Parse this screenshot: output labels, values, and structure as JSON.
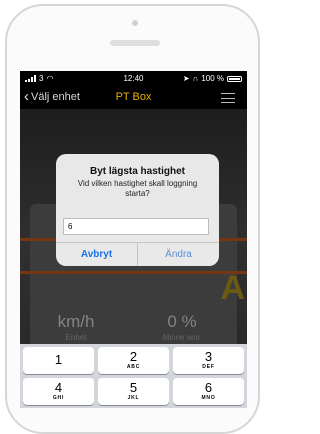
{
  "status_bar": {
    "carrier": "3",
    "time": "12:40",
    "battery": "100 %"
  },
  "nav": {
    "back_label": "Välj enhet",
    "title": "PT Box"
  },
  "background": {
    "unit_value": "km/h",
    "unit_label": "Enhet",
    "memory_value": "0 %",
    "memory_label": "Minne anv.",
    "partial_letter": "A"
  },
  "dialog": {
    "title": "Byt lägsta hastighet",
    "message": "Vid vilken hastighet skall loggning starta?",
    "input_value": "6",
    "cancel_label": "Avbryt",
    "confirm_label": "Ändra"
  },
  "keyboard": {
    "keys": [
      {
        "digit": "1",
        "letters": ""
      },
      {
        "digit": "2",
        "letters": "ABC"
      },
      {
        "digit": "3",
        "letters": "DEF"
      },
      {
        "digit": "4",
        "letters": "GHI"
      },
      {
        "digit": "5",
        "letters": "JKL"
      },
      {
        "digit": "6",
        "letters": "MNO"
      }
    ]
  },
  "colors": {
    "accent": "#e4b100",
    "dialog_button": "#1a73e8",
    "keyboard_bg": "#d2d5db"
  }
}
